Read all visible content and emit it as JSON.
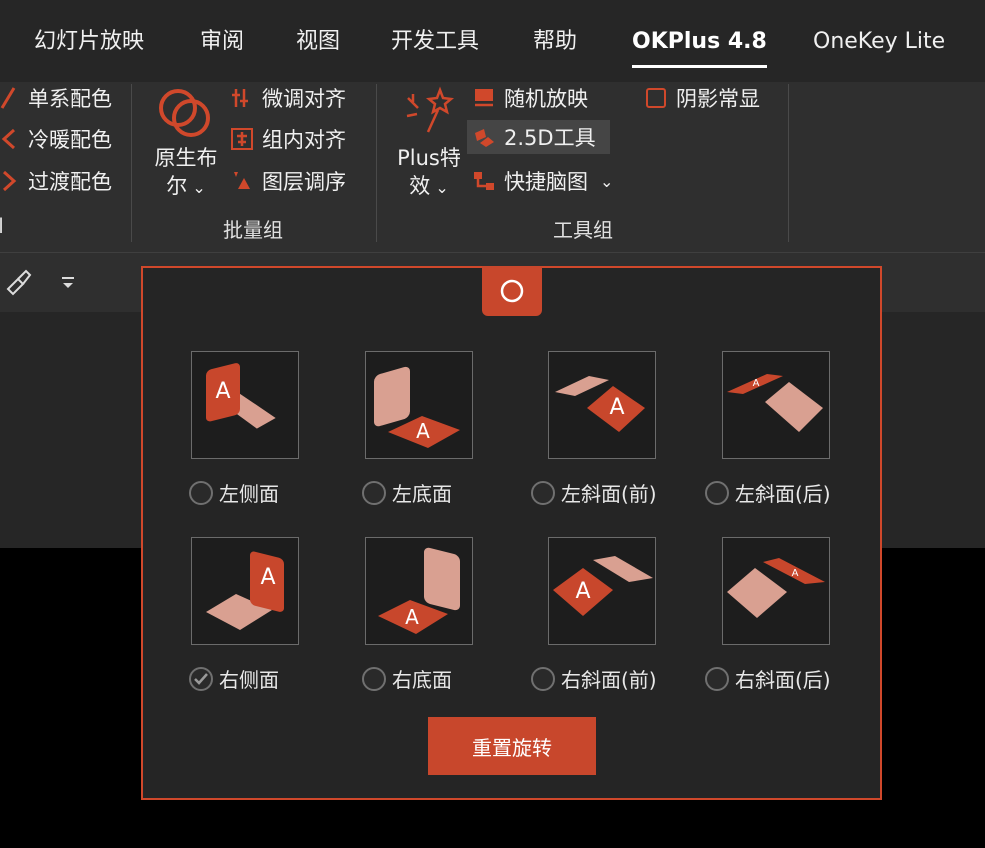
{
  "tabs": [
    {
      "label": "幻灯片放映"
    },
    {
      "label": "审阅"
    },
    {
      "label": "视图"
    },
    {
      "label": "开发工具"
    },
    {
      "label": "帮助"
    },
    {
      "label": "OKPlus 4.8",
      "active": true
    },
    {
      "label": "OneKey Lite"
    }
  ],
  "color_group": {
    "items": [
      {
        "label": "单系配色"
      },
      {
        "label": "冷暖配色"
      },
      {
        "label": "过渡配色"
      }
    ]
  },
  "batch_group": {
    "big_button": {
      "line1": "原生布",
      "line2": "尔"
    },
    "items": [
      {
        "label": "微调对齐"
      },
      {
        "label": "组内对齐"
      },
      {
        "label": "图层调序"
      }
    ],
    "label": "批量组"
  },
  "tool_group": {
    "big_button": {
      "line1": "Plus特",
      "line2": "效"
    },
    "items": [
      {
        "label": "随机放映"
      },
      {
        "label": "2.5D工具"
      },
      {
        "label": "快捷脑图"
      }
    ],
    "checkbox_label": "阴影常显",
    "label": "工具组"
  },
  "popup": {
    "options": [
      {
        "label": "左侧面",
        "checked": false
      },
      {
        "label": "左底面",
        "checked": false
      },
      {
        "label": "左斜面(前)",
        "checked": false
      },
      {
        "label": "左斜面(后)",
        "checked": false
      },
      {
        "label": "右侧面",
        "checked": true
      },
      {
        "label": "右底面",
        "checked": false
      },
      {
        "label": "右斜面(前)",
        "checked": false
      },
      {
        "label": "右斜面(后)",
        "checked": false
      }
    ],
    "tile_letter": "A",
    "reset_label": "重置旋转"
  },
  "colors": {
    "accent": "#c8472c",
    "face": "#d9a091",
    "panel": "#252525"
  }
}
